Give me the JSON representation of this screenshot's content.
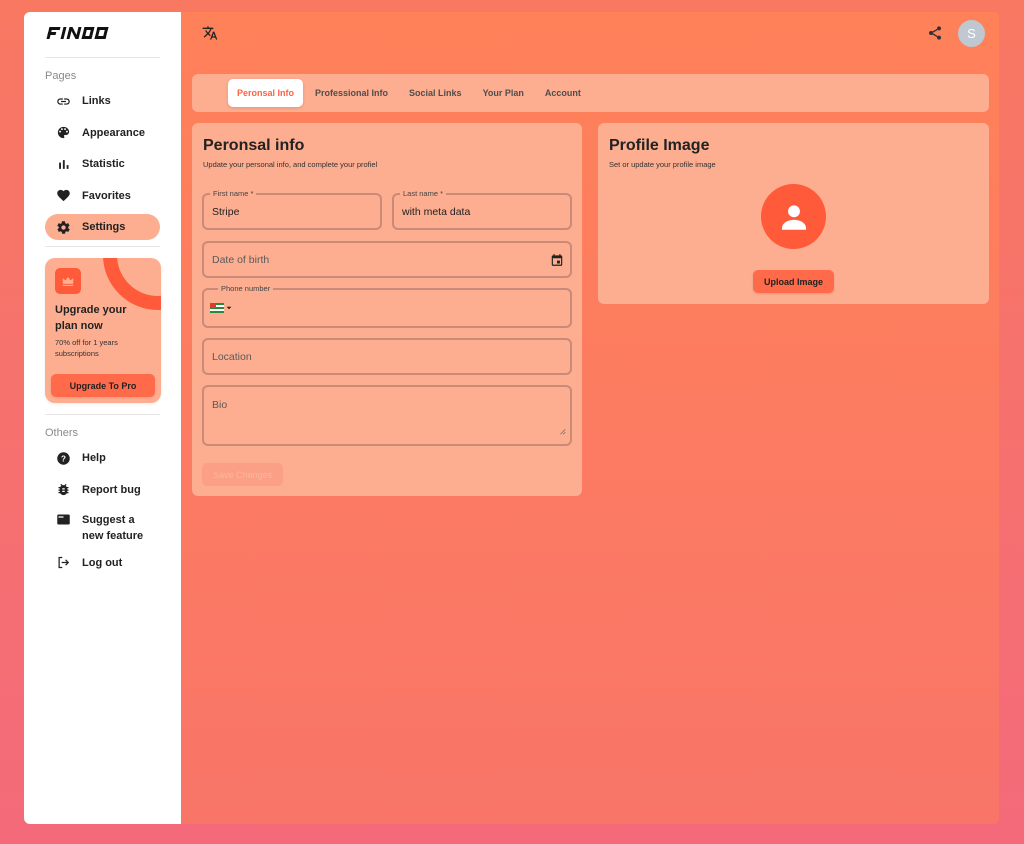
{
  "brand": {
    "logo_text": "FINDO"
  },
  "sidebar": {
    "pages_title": "Pages",
    "items": [
      {
        "label": "Links",
        "icon": "link-icon"
      },
      {
        "label": "Appearance",
        "icon": "palette-icon"
      },
      {
        "label": "Statistic",
        "icon": "bar-chart-icon"
      },
      {
        "label": "Favorites",
        "icon": "heart-icon"
      },
      {
        "label": "Settings",
        "icon": "gear-icon",
        "active": true
      }
    ],
    "upgrade": {
      "title": "Upgrade your plan now",
      "subtitle": "70% off for 1 years subscriptions",
      "button": "Upgrade To Pro"
    },
    "others_title": "Others",
    "others": [
      {
        "label": "Help",
        "icon": "help-icon"
      },
      {
        "label": "Report bug",
        "icon": "bug-icon"
      },
      {
        "label": "Suggest a new feature",
        "icon": "feature-icon"
      },
      {
        "label": "Log out",
        "icon": "logout-icon"
      }
    ]
  },
  "header": {
    "avatar_initial": "S"
  },
  "tabs": [
    {
      "label": "Peronsal Info",
      "active": true
    },
    {
      "label": "Professional Info"
    },
    {
      "label": "Social Links"
    },
    {
      "label": "Your Plan"
    },
    {
      "label": "Account"
    }
  ],
  "personal": {
    "title": "Peronsal info",
    "subtitle": "Update your personal info, and complete your profiel",
    "first_name_label": "First name *",
    "first_name_value": "Stripe",
    "last_name_label": "Last name *",
    "last_name_value": "with meta data",
    "dob_placeholder": "Date of birth",
    "phone_label": "Phone number",
    "location_placeholder": "Location",
    "bio_placeholder": "Bio",
    "save_button": "Save Changes"
  },
  "profile": {
    "title": "Profile Image",
    "subtitle": "Set or update your profile image",
    "upload_button": "Upload Image"
  },
  "colors": {
    "accent": "#ff5a3a",
    "card": "#fdad90",
    "active_tab_text": "#ff6242"
  }
}
